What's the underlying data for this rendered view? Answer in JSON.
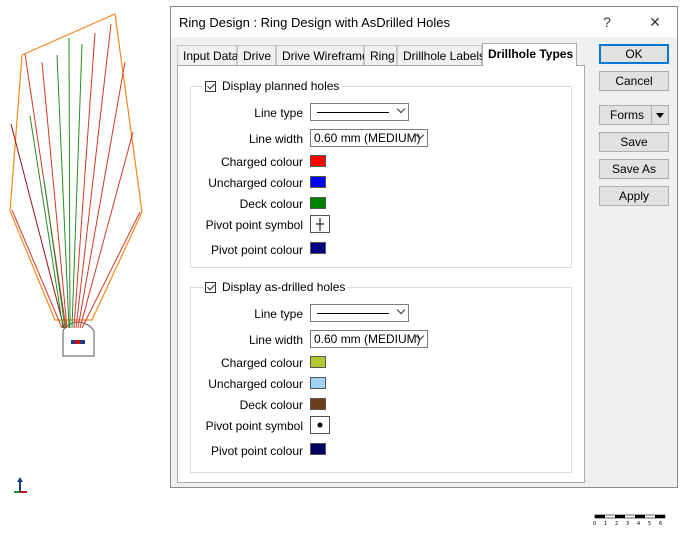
{
  "window": {
    "title": "Ring Design : Ring Design with AsDrilled Holes",
    "help_label": "?",
    "close_label": "✕"
  },
  "tabs": [
    "Input Data",
    "Drive",
    "Drive Wireframe",
    "Ring",
    "Drillhole Labels",
    "Drillhole Types"
  ],
  "active_tab": "Drillhole Types",
  "planned": {
    "checkbox_label": "Display planned holes",
    "checked": true,
    "line_type_label": "Line type",
    "line_width_label": "Line width",
    "line_width_value": "0.60 mm (MEDIUM)",
    "charged_label": "Charged colour",
    "charged_color": "#ff0000",
    "uncharged_label": "Uncharged colour",
    "uncharged_color": "#0000ff",
    "deck_label": "Deck colour",
    "deck_color": "#008000",
    "pivot_symbol_label": "Pivot point symbol",
    "pivot_symbol_icon": "vertical-cross-icon",
    "pivot_colour_label": "Pivot point colour",
    "pivot_color": "#000080"
  },
  "drilled": {
    "checkbox_label": "Display as-drilled holes",
    "checked": true,
    "line_type_label": "Line type",
    "line_width_label": "Line width",
    "line_width_value": "0.60 mm (MEDIUM)",
    "charged_label": "Charged colour",
    "charged_color": "#b4c832",
    "uncharged_label": "Uncharged colour",
    "uncharged_color": "#9cd3f5",
    "deck_label": "Deck colour",
    "deck_color": "#6b3f1e",
    "pivot_symbol_label": "Pivot point symbol",
    "pivot_symbol_icon": "dot-icon",
    "pivot_colour_label": "Pivot point colour",
    "pivot_color": "#000060"
  },
  "buttons": {
    "ok": "OK",
    "cancel": "Cancel",
    "forms": "Forms",
    "save": "Save",
    "save_as": "Save As",
    "apply": "Apply"
  },
  "scale_bar_ticks": [
    "0",
    "1",
    "2",
    "3",
    "4",
    "5",
    "6"
  ]
}
